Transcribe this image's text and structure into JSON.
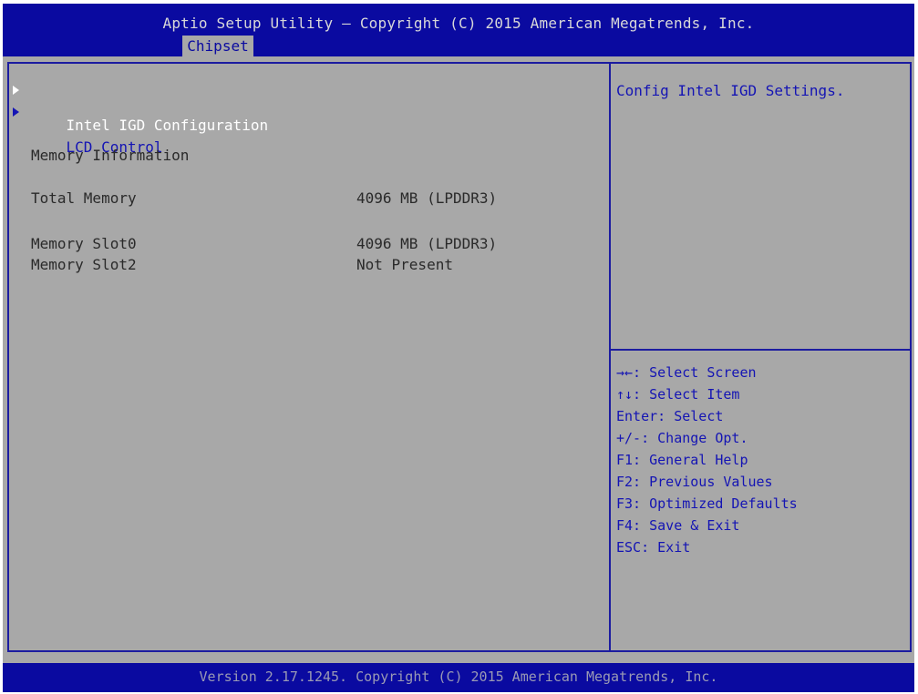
{
  "header": {
    "title": "Aptio Setup Utility – Copyright (C) 2015 American Megatrends, Inc.",
    "active_tab": "Chipset"
  },
  "menu": {
    "items": [
      {
        "label": "Intel IGD Configuration",
        "icon": "submenu-arrow-icon"
      },
      {
        "label": "LCD Control",
        "icon": "submenu-arrow-icon"
      }
    ]
  },
  "memory": {
    "section_title": "Memory Information",
    "total_label": "Total Memory",
    "total_value": "4096 MB (LPDDR3)",
    "slots": [
      {
        "label": "Memory Slot0",
        "value": "4096 MB (LPDDR3)"
      },
      {
        "label": "Memory Slot2",
        "value": "Not Present"
      }
    ]
  },
  "help": {
    "description": "Config Intel IGD Settings.",
    "keys": [
      "→←: Select Screen",
      "↑↓: Select Item",
      "Enter: Select",
      "+/-: Change Opt.",
      "F1: General Help",
      "F2: Previous Values",
      "F3: Optimized Defaults",
      "F4: Save & Exit",
      "ESC: Exit"
    ]
  },
  "footer": {
    "version": "Version 2.17.1245. Copyright (C) 2015 American Megatrends, Inc."
  },
  "colors": {
    "header_bg": "#0a0aa0",
    "panel_bg": "#a8a8a8",
    "highlight_text": "#ffffff",
    "link_text": "#1414b4"
  }
}
